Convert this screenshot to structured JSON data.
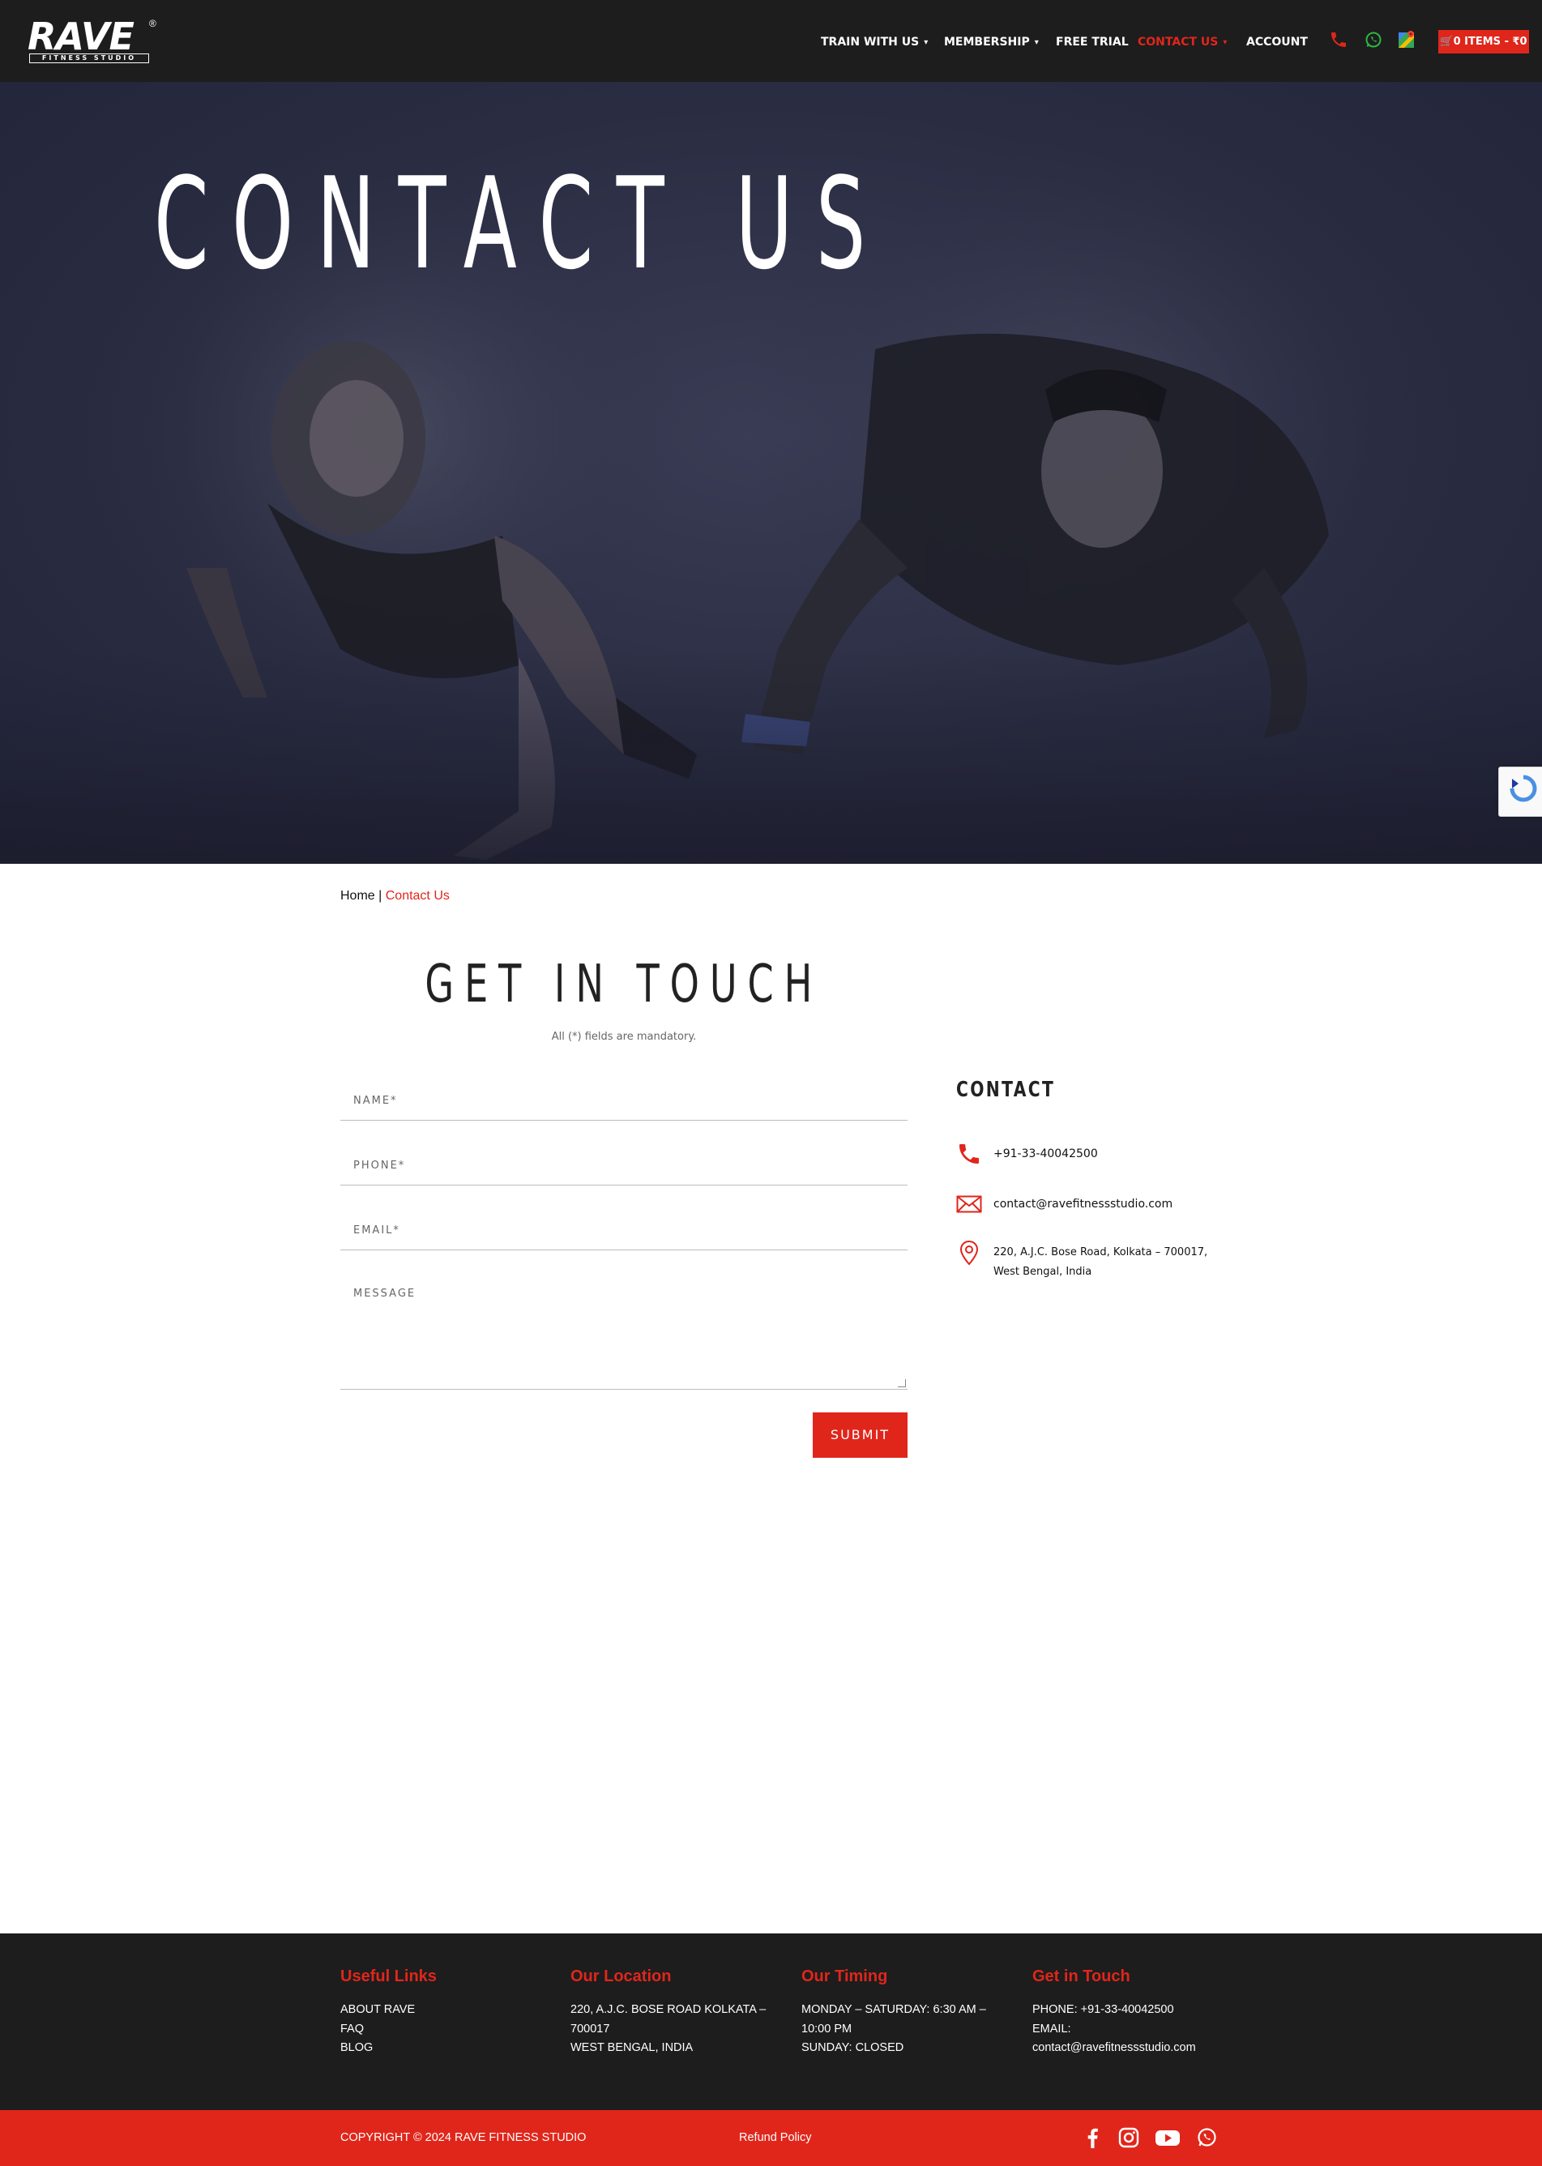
{
  "header": {
    "logo": {
      "word": "RAVE",
      "sub": "FITNESS STUDIO",
      "reg": "®"
    },
    "nav": [
      {
        "label": "TRAIN WITH US",
        "has_dropdown": true,
        "active": false
      },
      {
        "label": "MEMBERSHIP",
        "has_dropdown": true,
        "active": false
      },
      {
        "label": "FREE TRIAL",
        "has_dropdown": false,
        "active": false
      },
      {
        "label": "CONTACT US",
        "has_dropdown": true,
        "active": true
      },
      {
        "label": "ACCOUNT",
        "has_dropdown": false,
        "active": false
      }
    ],
    "icons": [
      "phone-icon",
      "whatsapp-icon",
      "map-icon"
    ],
    "cart_label": "0 ITEMS - ₹0"
  },
  "hero": {
    "title": "CONTACT US"
  },
  "breadcrumb": {
    "home": "Home",
    "separator": " | ",
    "current": "Contact Us"
  },
  "form": {
    "title": "GET IN TOUCH",
    "note": "All (*) fields are mandatory.",
    "name_placeholder": "NAME*",
    "phone_placeholder": "PHONE*",
    "email_placeholder": "EMAIL*",
    "message_placeholder": "MESSAGE",
    "submit_label": "SUBMIT"
  },
  "contact": {
    "heading": "CONTACT",
    "phone": "+91-33-40042500",
    "email": "contact@ravefitnessstudio.com",
    "address": "220, A.J.C. Bose Road, Kolkata – 700017, West Bengal, India"
  },
  "footer": {
    "useful_links": {
      "title": "Useful Links",
      "items": [
        "ABOUT RAVE",
        "FAQ",
        "BLOG"
      ]
    },
    "location": {
      "title": "Our Location",
      "lines": [
        "220, A.J.C. BOSE ROAD KOLKATA –",
        "700017",
        "WEST BENGAL, INDIA"
      ]
    },
    "timing": {
      "title": "Our Timing",
      "lines": [
        "MONDAY – SATURDAY: 6:30 AM –",
        "10:00 PM",
        "SUNDAY: CLOSED"
      ]
    },
    "get_in_touch": {
      "title": "Get in Touch",
      "lines": [
        "PHONE: +91-33-40042500",
        "EMAIL:",
        "contact@ravefitnessstudio.com"
      ]
    },
    "copyright": "COPYRIGHT © 2024 RAVE FITNESS STUDIO",
    "refund": "Refund Policy",
    "social": [
      "facebook-icon",
      "instagram-icon",
      "youtube-icon",
      "whatsapp-icon"
    ]
  },
  "colors": {
    "accent": "#e0261b",
    "dark": "#1d1d1d",
    "hero": "#2a2c42",
    "whatsapp": "#2db742"
  }
}
